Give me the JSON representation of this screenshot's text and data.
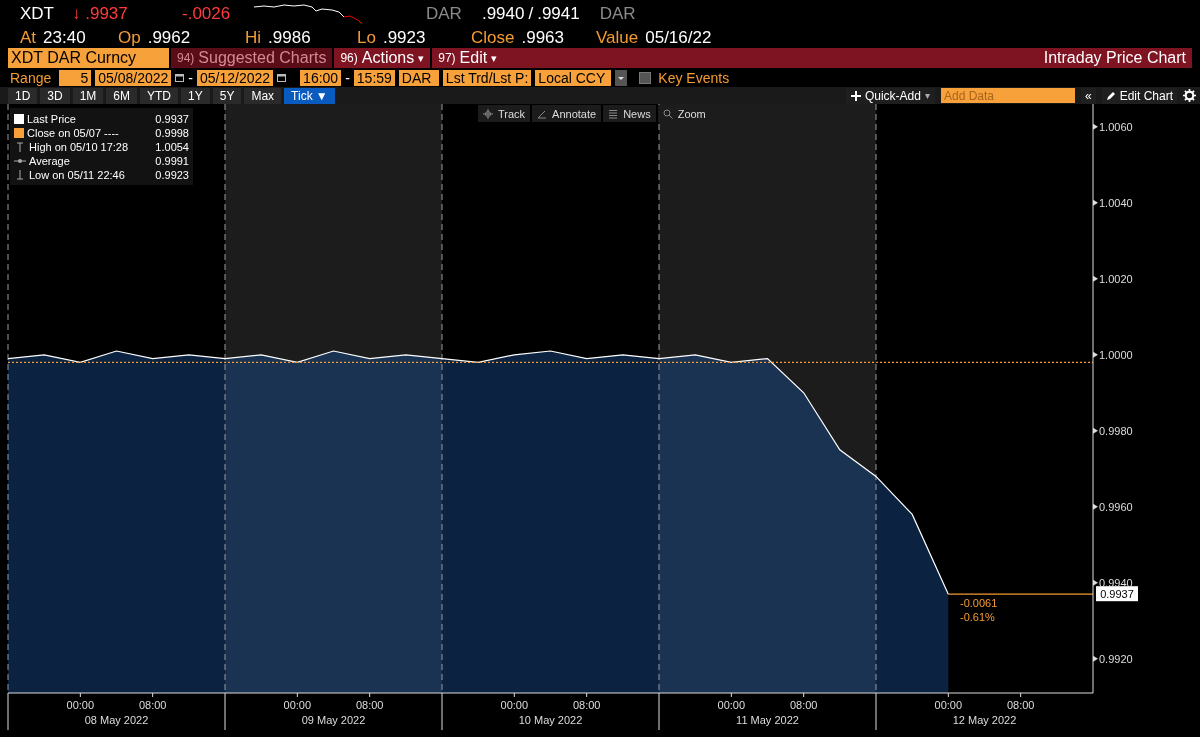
{
  "quote": {
    "ticker": "XDT",
    "arrow": "↓",
    "last": ".9937",
    "change": "-.0026",
    "source": "DAR",
    "bid": ".9940",
    "separator": "/",
    "ask": ".9941",
    "ask_source": "DAR"
  },
  "stats": [
    {
      "label": "At",
      "value": "23:40"
    },
    {
      "label": "Op",
      "value": ".9962"
    },
    {
      "label": "Hi",
      "value": ".9986"
    },
    {
      "label": "Lo",
      "value": ".9923"
    },
    {
      "label": "Close",
      "value": ".9963"
    },
    {
      "label": "Value",
      "value": "05/16/22"
    }
  ],
  "command_bar": {
    "security": "XDT DAR Curncy",
    "buttons": [
      {
        "number": "94)",
        "label": "Suggested Charts",
        "disabled": true
      },
      {
        "number": "96)",
        "label": "Actions",
        "caret": "▾",
        "disabled": false
      },
      {
        "number": "97)",
        "label": "Edit",
        "caret": "▾",
        "disabled": false
      }
    ],
    "title": "Intraday Price Chart"
  },
  "range_bar": {
    "label": "Range",
    "count": "5",
    "start_date": "05/08/2022",
    "date_separator": "-",
    "end_date": "05/12/2022",
    "start_time": "16:00",
    "time_separator": "-",
    "end_time": "15:59",
    "source": "DAR",
    "field": "Lst Trd/Lst P:",
    "currency": "Local CCY",
    "key_events": {
      "label": "Key Events",
      "checked": false
    }
  },
  "periods": [
    {
      "label": "1D",
      "selected": false
    },
    {
      "label": "3D",
      "selected": false
    },
    {
      "label": "1M",
      "selected": false
    },
    {
      "label": "6M",
      "selected": false
    },
    {
      "label": "YTD",
      "selected": false
    },
    {
      "label": "1Y",
      "selected": false
    },
    {
      "label": "5Y",
      "selected": false
    },
    {
      "label": "Max",
      "selected": false
    },
    {
      "label": "Tick",
      "caret": "▼",
      "selected": true
    }
  ],
  "toolbar": {
    "quick_add": {
      "label": "Quick-Add",
      "caret": "▾"
    },
    "add_data": {
      "placeholder": "Add Data"
    },
    "collapse": "«",
    "edit_chart": "Edit Chart"
  },
  "chart": {
    "tools": [
      "Track",
      "Annotate",
      "News",
      "Zoom"
    ],
    "legend": [
      {
        "kind": "swatch",
        "color": "#ffffff",
        "label": "Last Price",
        "value": "0.9937"
      },
      {
        "kind": "swatch",
        "color": "#f7a13b",
        "label": "Close on 05/07 ----",
        "value": "0.9998"
      },
      {
        "kind": "high",
        "label": "High on 05/10 17:28",
        "value": "1.0054"
      },
      {
        "kind": "average",
        "label": "Average",
        "value": "0.9991"
      },
      {
        "kind": "low",
        "label": "Low on 05/11 22:46",
        "value": "0.9923"
      }
    ],
    "change": {
      "absolute": "-0.0061",
      "percent": "-0.61%"
    },
    "day_labels": [
      "08 May 2022",
      "09 May 2022",
      "10 May 2022",
      "11 May 2022",
      "12 May 2022"
    ],
    "chart_data": {
      "type": "area",
      "categories": [
        null,
        null,
        "00:00",
        null,
        "08:00",
        null,
        null,
        null,
        "00:00",
        null,
        "08:00",
        null,
        null,
        null,
        "00:00",
        null,
        "08:00",
        null,
        null,
        null,
        "00:00",
        null,
        "08:00",
        null,
        null,
        null,
        "00:00",
        null,
        "08:00",
        null,
        null
      ],
      "series": [
        {
          "color": "#ffffff",
          "values": [
            0.9999,
            1.0,
            0.9998,
            1.0001,
            0.9999,
            1.0,
            0.9999,
            1.0,
            0.9998,
            1.0001,
            0.9999,
            1.0,
            0.9999,
            0.9998,
            1.0,
            1.0001,
            0.9999,
            1.0,
            0.9999,
            1.0,
            0.9998,
            0.9999,
            0.999,
            0.9975,
            0.9968,
            0.9958,
            0.9937,
            null,
            null,
            null,
            null
          ]
        }
      ],
      "ylim": [
        0.9911,
        1.0066
      ],
      "yticks": [
        {
          "value": 0.992,
          "label": "0.9920"
        },
        {
          "value": 0.994,
          "label": "0.9940"
        },
        {
          "value": 0.996,
          "label": "0.9960"
        },
        {
          "value": 0.998,
          "label": "0.9980"
        },
        {
          "value": 1.0,
          "label": "1.0000"
        },
        {
          "value": 1.002,
          "label": "1.0020"
        },
        {
          "value": 1.004,
          "label": "1.0040"
        },
        {
          "value": 1.006,
          "label": "1.0060"
        }
      ],
      "grid": true,
      "ref_lines": [
        {
          "axis": "y",
          "value": 0.9998
        },
        {
          "axis": "y",
          "value": 0.9937,
          "label": "0.9937"
        }
      ]
    }
  }
}
